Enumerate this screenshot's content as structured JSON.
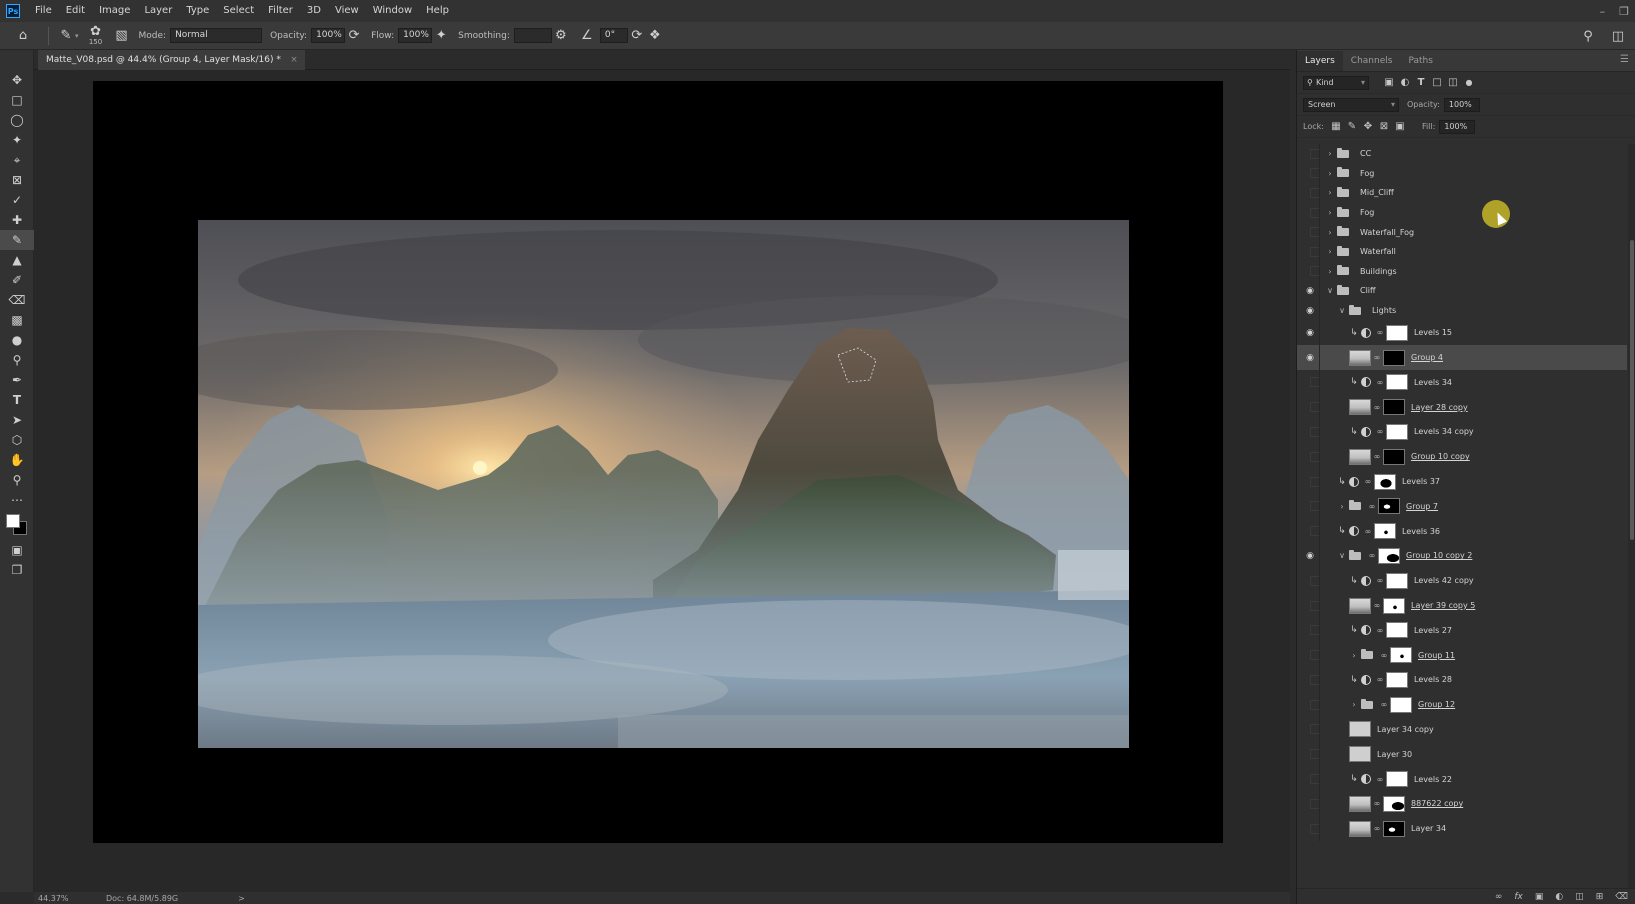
{
  "menubar": {
    "items": [
      "File",
      "Edit",
      "Image",
      "Layer",
      "Type",
      "Select",
      "Filter",
      "3D",
      "View",
      "Window",
      "Help"
    ],
    "logo": "Ps"
  },
  "options": {
    "brush_size": "150",
    "mode_label": "Mode:",
    "mode_value": "Normal",
    "opacity_label": "Opacity:",
    "opacity_value": "100%",
    "flow_label": "Flow:",
    "flow_value": "100%",
    "smoothing_label": "Smoothing:",
    "smoothing_value": "",
    "angle_value": "0°"
  },
  "document": {
    "tab_title": "Matte_V08.psd @ 44.4% (Group 4, Layer Mask/16) *",
    "close_glyph": "×"
  },
  "status": {
    "zoom": "44.37%",
    "doc_size": "Doc: 64.8M/5.89G",
    "arrow": ">"
  },
  "layers_panel": {
    "tabs": [
      "Layers",
      "Channels",
      "Paths"
    ],
    "kind_filter": "Kind",
    "blend_mode": "Screen",
    "opacity_label": "Opacity:",
    "opacity_value": "100%",
    "lock_label": "Lock:",
    "fill_label": "Fill:",
    "fill_value": "100%",
    "layers": [
      {
        "name": "CC",
        "type": "group",
        "visible": false,
        "indent": 0
      },
      {
        "name": "Fog",
        "type": "group",
        "visible": false,
        "indent": 0
      },
      {
        "name": "Mid_Cliff",
        "type": "group",
        "visible": false,
        "indent": 0
      },
      {
        "name": "Fog",
        "type": "group",
        "visible": false,
        "indent": 0
      },
      {
        "name": "Waterfall_Fog",
        "type": "group",
        "visible": false,
        "indent": 0
      },
      {
        "name": "Waterfall",
        "type": "group",
        "visible": false,
        "indent": 0
      },
      {
        "name": "Buildings",
        "type": "group",
        "visible": false,
        "indent": 0
      },
      {
        "name": "Cliff",
        "type": "group-open",
        "visible": true,
        "indent": 0
      },
      {
        "name": "Lights",
        "type": "group-open",
        "visible": true,
        "indent": 1
      },
      {
        "name": "Levels 15",
        "type": "adjust",
        "visible": true,
        "indent": 2,
        "thumb": "white"
      },
      {
        "name": "Group 4",
        "type": "smart",
        "visible": true,
        "indent": 2,
        "thumb": "black",
        "selected": true,
        "underline": true
      },
      {
        "name": "Levels 34",
        "type": "adjust",
        "visible": false,
        "indent": 2,
        "thumb": "white"
      },
      {
        "name": "Layer 28 copy",
        "type": "smart",
        "visible": false,
        "indent": 2,
        "thumb": "black",
        "underline": true
      },
      {
        "name": "Levels 34 copy",
        "type": "adjust",
        "visible": false,
        "indent": 2,
        "thumb": "white"
      },
      {
        "name": "Group 10 copy",
        "type": "smart",
        "visible": false,
        "indent": 2,
        "thumb": "black",
        "underline": true
      },
      {
        "name": "Levels 37",
        "type": "adjust",
        "visible": false,
        "indent": 1,
        "thumb": "shape"
      },
      {
        "name": "Group 7",
        "type": "group-mask",
        "visible": false,
        "indent": 1,
        "thumb": "blackshape",
        "underline": true
      },
      {
        "name": "Levels 36",
        "type": "adjust",
        "visible": false,
        "indent": 1,
        "thumb": "dot"
      },
      {
        "name": "Group 10 copy 2",
        "type": "group-mask-open",
        "visible": true,
        "indent": 1,
        "thumb": "shape2",
        "underline": true
      },
      {
        "name": "Levels 42 copy",
        "type": "adjust",
        "visible": false,
        "indent": 2,
        "thumb": "white"
      },
      {
        "name": "Layer 39 copy 5",
        "type": "smart",
        "visible": false,
        "indent": 2,
        "thumb": "dot",
        "underline": true
      },
      {
        "name": "Levels 27",
        "type": "adjust",
        "visible": false,
        "indent": 2,
        "thumb": "white"
      },
      {
        "name": "Group 11",
        "type": "group-mask",
        "visible": false,
        "indent": 2,
        "thumb": "dot",
        "underline": true
      },
      {
        "name": "Levels 28",
        "type": "adjust",
        "visible": false,
        "indent": 2,
        "thumb": "white"
      },
      {
        "name": "Group 12",
        "type": "group-mask",
        "visible": false,
        "indent": 2,
        "thumb": "white",
        "underline": true
      },
      {
        "name": "Layer 34 copy",
        "type": "pixel",
        "visible": false,
        "indent": 2
      },
      {
        "name": "Layer 30",
        "type": "pixel",
        "visible": false,
        "indent": 2
      },
      {
        "name": "Levels 22",
        "type": "adjust",
        "visible": false,
        "indent": 2,
        "thumb": "white"
      },
      {
        "name": "887622 copy",
        "type": "smart",
        "visible": false,
        "indent": 2,
        "thumb": "shape2",
        "underline": true
      },
      {
        "name": "Layer 34",
        "type": "smart",
        "visible": false,
        "indent": 2,
        "thumb": "blackshape"
      }
    ]
  },
  "colors": {
    "foreground": "#ffffff",
    "background": "#000000",
    "accent": "#31a8ff"
  }
}
